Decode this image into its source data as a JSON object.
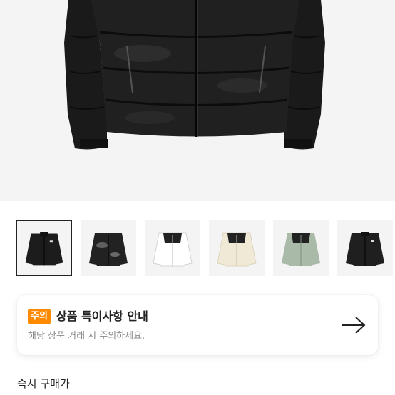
{
  "product_image": {
    "alt": "black puffer jacket",
    "colors": {
      "jacket": "#1d1d1d",
      "background": "#f4f4f4"
    }
  },
  "thumbnails": [
    {
      "name": "black",
      "selected": true
    },
    {
      "name": "black-shiny",
      "selected": false
    },
    {
      "name": "white",
      "selected": false
    },
    {
      "name": "cream",
      "selected": false
    },
    {
      "name": "sage-green",
      "selected": false
    },
    {
      "name": "black-alt",
      "selected": false
    }
  ],
  "notice": {
    "badge": "주의",
    "title": "상품 특이사항 안내",
    "subtitle": "해당 상품 거래 시 주의하세요.",
    "badge_color": "#ff8a00"
  },
  "section": {
    "title": "즉시 구매가"
  }
}
